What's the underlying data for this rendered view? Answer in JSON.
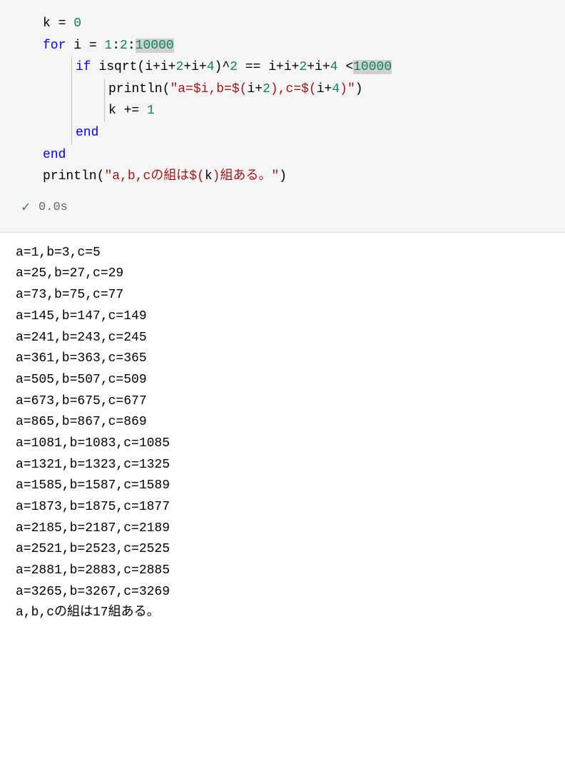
{
  "code": {
    "l1": {
      "a": "k ",
      "b": "= ",
      "c": "0"
    },
    "l2": {
      "a": "for",
      "b": " i ",
      "c": "= ",
      "d": "1",
      "e": ":",
      "f": "2",
      "g": ":",
      "h": "10000"
    },
    "l3": {
      "a": "if",
      "b": " isqrt(i",
      "c": "+",
      "d": "i",
      "e": "+",
      "f": "2",
      "g": "+",
      "h": "i",
      "i": "+",
      "j": "4",
      "k": ")",
      "l": "^",
      "m": "2",
      "n": " ",
      "o": "==",
      "p": " i",
      "q": "+",
      "r": "i",
      "s": "+",
      "t": "2",
      "u": "+",
      "v": "i",
      "w": "+",
      "x": "4",
      "y": " ",
      "z": "<",
      "aa": "10000"
    },
    "l4": {
      "a": "println",
      "b": "(",
      "c": "\"a=",
      "d": "$i",
      "e": ",b=",
      "f": "$(",
      "g": "i",
      "h": "+",
      "i": "2",
      "j": ")",
      "k": ",c=",
      "l": "$(",
      "m": "i",
      "n": "+",
      "o": "4",
      "p": ")",
      "q": "\"",
      "r": ")"
    },
    "l5": {
      "a": "k ",
      "b": "+=",
      "c": " ",
      "d": "1"
    },
    "l6": {
      "a": "end"
    },
    "l7": {
      "a": "end"
    },
    "l8": {
      "a": "println",
      "b": "(",
      "c": "\"a,b,cの組は",
      "d": "$(",
      "e": "k",
      "f": ")",
      "g": "組ある。\"",
      "h": ")"
    }
  },
  "status": {
    "check": "✓",
    "time": "0.0s"
  },
  "output_lines": [
    "a=1,b=3,c=5",
    "a=25,b=27,c=29",
    "a=73,b=75,c=77",
    "a=145,b=147,c=149",
    "a=241,b=243,c=245",
    "a=361,b=363,c=365",
    "a=505,b=507,c=509",
    "a=673,b=675,c=677",
    "a=865,b=867,c=869",
    "a=1081,b=1083,c=1085",
    "a=1321,b=1323,c=1325",
    "a=1585,b=1587,c=1589",
    "a=1873,b=1875,c=1877",
    "a=2185,b=2187,c=2189",
    "a=2521,b=2523,c=2525",
    "a=2881,b=2883,c=2885",
    "a=3265,b=3267,c=3269",
    "a,b,cの組は17組ある。"
  ]
}
